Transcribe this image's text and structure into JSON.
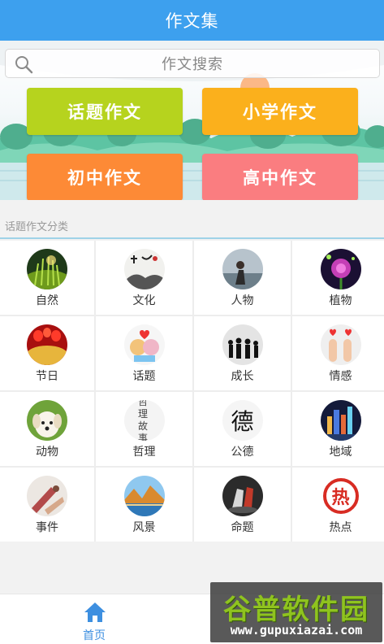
{
  "titlebar": {
    "title": "作文集"
  },
  "search": {
    "placeholder": "作文搜索"
  },
  "categories": {
    "topic": "话题作文",
    "primary": "小学作文",
    "junior": "初中作文",
    "senior": "高中作文",
    "colors": {
      "topic": "#b6d31e",
      "primary": "#fbb01c",
      "junior": "#fd8a36",
      "senior": "#fa7d80"
    }
  },
  "section": {
    "title": "话题作文分类"
  },
  "grid": {
    "items": [
      {
        "label": "自然",
        "icon": "nature-icon"
      },
      {
        "label": "文化",
        "icon": "culture-icon"
      },
      {
        "label": "人物",
        "icon": "people-icon"
      },
      {
        "label": "植物",
        "icon": "plant-icon"
      },
      {
        "label": "节日",
        "icon": "festival-icon"
      },
      {
        "label": "话题",
        "icon": "topic-icon"
      },
      {
        "label": "成长",
        "icon": "growth-icon"
      },
      {
        "label": "情感",
        "icon": "emotion-icon"
      },
      {
        "label": "动物",
        "icon": "animal-icon"
      },
      {
        "label": "哲理",
        "icon": "philosophy-icon",
        "thumb_text": "哲 理 故 事"
      },
      {
        "label": "公德",
        "icon": "morality-icon",
        "thumb_text": "德"
      },
      {
        "label": "地域",
        "icon": "region-icon"
      },
      {
        "label": "事件",
        "icon": "event-icon"
      },
      {
        "label": "风景",
        "icon": "scenery-icon"
      },
      {
        "label": "命题",
        "icon": "proposition-icon"
      },
      {
        "label": "热点",
        "icon": "hotspot-icon",
        "thumb_text": "热"
      }
    ]
  },
  "tabbar": {
    "home_label": "首页",
    "accent": "#3d8fe0"
  },
  "watermark": {
    "brand": "谷普软件园",
    "url": "www.gupuxiazai.com"
  }
}
